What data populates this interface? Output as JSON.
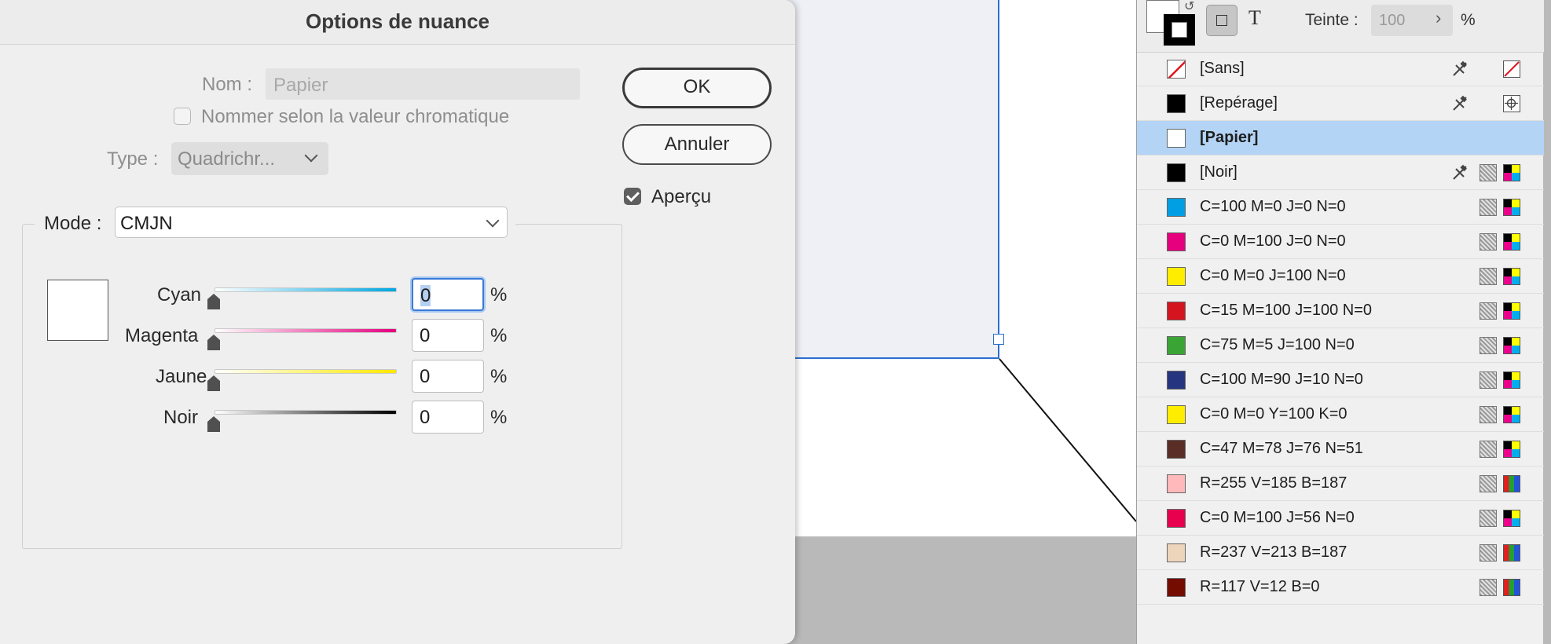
{
  "dialog": {
    "title": "Options de nuance",
    "name_label": "Nom :",
    "name_value": "Papier",
    "name_by_value_label": "Nommer selon la valeur chromatique",
    "type_label": "Type :",
    "type_value": "Quadrichr...",
    "mode_label": "Mode :",
    "mode_value": "CMJN",
    "ok_label": "OK",
    "cancel_label": "Annuler",
    "preview_label": "Aperçu",
    "preview_checked": true,
    "swatch_color": "#ffffff",
    "channels": [
      {
        "label": "Cyan",
        "value": "0",
        "unit": "%",
        "color": "#00a6e0"
      },
      {
        "label": "Magenta",
        "value": "0",
        "unit": "%",
        "color": "#e4007f"
      },
      {
        "label": "Jaune",
        "value": "0",
        "unit": "%",
        "color": "#ffe800"
      },
      {
        "label": "Noir",
        "value": "0",
        "unit": "%",
        "color": "#000000"
      }
    ]
  },
  "panel": {
    "tint_label": "Teinte :",
    "tint_value": "100",
    "tint_unit": "%",
    "swatches": [
      {
        "name": "[Sans]",
        "chip": "none",
        "icons": [
          "lock-icon",
          "none-icon"
        ]
      },
      {
        "name": "[Repérage]",
        "chip": "#000000",
        "icons": [
          "lock-icon",
          "registration-icon"
        ]
      },
      {
        "name": "[Papier]",
        "chip": "#ffffff",
        "icons": [],
        "selected": true
      },
      {
        "name": "[Noir]",
        "chip": "#000000",
        "icons": [
          "lock-icon",
          "process-icon",
          "cmyk-icon"
        ]
      },
      {
        "name": "C=100 M=0 J=0 N=0",
        "chip": "#009fe3",
        "icons": [
          "process-icon",
          "cmyk-icon"
        ]
      },
      {
        "name": "C=0 M=100 J=0 N=0",
        "chip": "#e6007e",
        "icons": [
          "process-icon",
          "cmyk-icon"
        ]
      },
      {
        "name": "C=0 M=0 J=100 N=0",
        "chip": "#ffed00",
        "icons": [
          "process-icon",
          "cmyk-icon"
        ]
      },
      {
        "name": "C=15 M=100 J=100 N=0",
        "chip": "#d4141e",
        "icons": [
          "process-icon",
          "cmyk-icon"
        ]
      },
      {
        "name": "C=75 M=5 J=100 N=0",
        "chip": "#3aa535",
        "icons": [
          "process-icon",
          "cmyk-icon"
        ]
      },
      {
        "name": "C=100 M=90 J=10 N=0",
        "chip": "#25357f",
        "icons": [
          "process-icon",
          "cmyk-icon"
        ]
      },
      {
        "name": "C=0 M=0 Y=100 K=0",
        "chip": "#ffed00",
        "icons": [
          "process-icon",
          "cmyk-icon"
        ]
      },
      {
        "name": "C=47 M=78 J=76 N=51",
        "chip": "#5a2e27",
        "icons": [
          "process-icon",
          "cmyk-icon"
        ]
      },
      {
        "name": "R=255 V=185 B=187",
        "chip": "#ffb9bb",
        "icons": [
          "process-icon",
          "rgb-icon"
        ]
      },
      {
        "name": "C=0 M=100 J=56 N=0",
        "chip": "#e6004e",
        "icons": [
          "process-icon",
          "cmyk-icon"
        ]
      },
      {
        "name": "R=237 V=213 B=187",
        "chip": "#edd5bb",
        "icons": [
          "process-icon",
          "rgb-icon"
        ]
      },
      {
        "name": "R=117 V=12 B=0",
        "chip": "#750c00",
        "icons": [
          "process-icon",
          "rgb-icon"
        ]
      }
    ]
  }
}
